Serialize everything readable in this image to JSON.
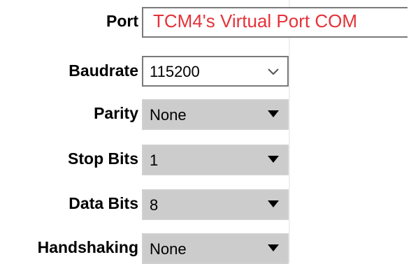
{
  "rows": [
    {
      "label": "Port",
      "value": "TCM4's Virtual Port COM",
      "control": "text"
    },
    {
      "label": "Baudrate",
      "value": "115200",
      "control": "combo-editable"
    },
    {
      "label": "Parity",
      "value": "None",
      "control": "combo-disabled"
    },
    {
      "label": "Stop Bits",
      "value": "1",
      "control": "combo-disabled"
    },
    {
      "label": "Data Bits",
      "value": "8",
      "control": "combo-disabled"
    },
    {
      "label": "Handshaking",
      "value": "None",
      "control": "combo-disabled"
    }
  ],
  "icons": {
    "baudrate_dropdown": "chevron-down-icon",
    "disabled_dropdown": "dropdown-triangle-icon"
  },
  "colors": {
    "port_text": "#e5323a",
    "disabled_bg": "#cccccc",
    "border": "#7a7a7a"
  }
}
